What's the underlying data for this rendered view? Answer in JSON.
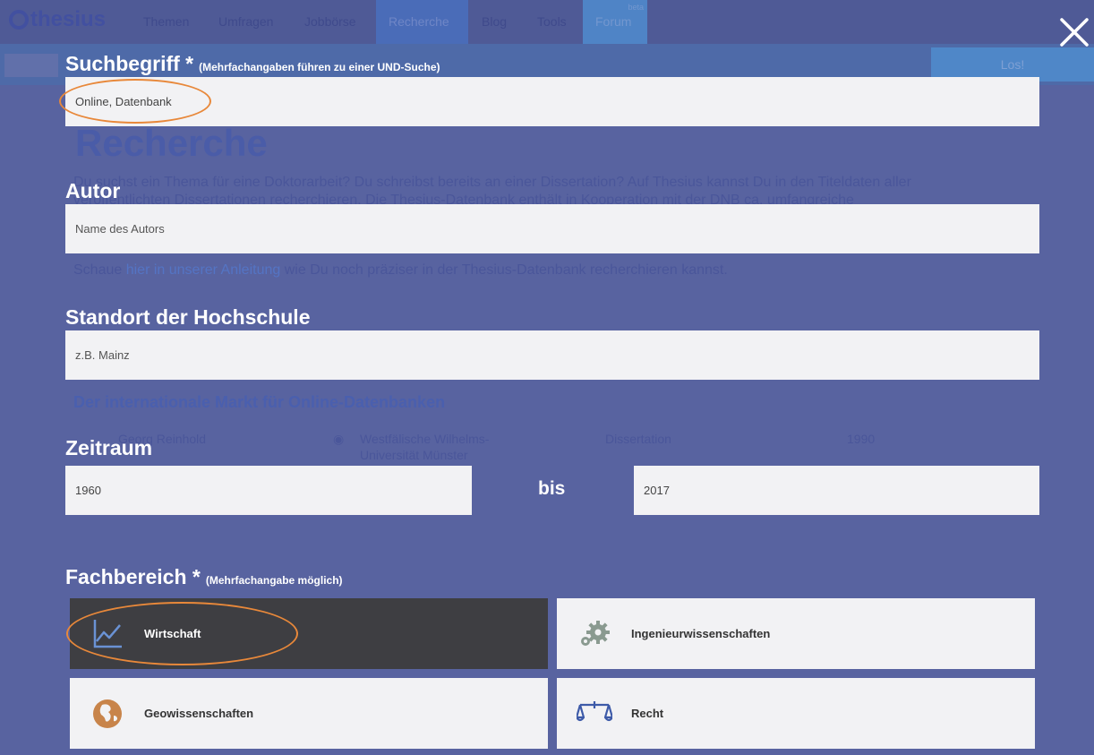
{
  "background": {
    "logo_text": "thesius",
    "nav": [
      "Themen",
      "Umfragen",
      "Jobbörse",
      "Recherche",
      "Blog",
      "Tools",
      "Forum"
    ],
    "forum_badge": "beta",
    "search_button": "Los!",
    "page_title": "Recherche",
    "intro_line1": "Du suchst ein Thema für eine Doktorarbeit? Du schreibst bereits an einer Dissertation? Auf Thesius kannst Du in den Titeldaten aller",
    "intro_line2": "veröffentlichten Dissertationen recherchieren. Die Thesius-Datenbank enthält in Kooperation mit der DNB ca. umfangreiche",
    "hint_prefix": "Schaue",
    "hint_link": "hier in unserer Anleitung",
    "hint_suffix": "wie Du noch präziser in der Thesius-Datenbank recherchieren kannst.",
    "result_title": "Der internationale Markt für Online-Datenbanken",
    "result_author": "Georg Reinhold",
    "result_university_line1": "Westfälische Wilhelms-",
    "result_university_line2": "Universität Münster",
    "result_type": "Dissertation",
    "result_year": "1990"
  },
  "form": {
    "search_label": "Suchbegriff *",
    "search_hint": "(Mehrfachangaben führen zu einer UND-Suche)",
    "search_value": "Online, Datenbank",
    "author_label": "Autor",
    "author_placeholder": "Name des Autors",
    "location_label": "Standort der Hochschule",
    "location_placeholder": "z.B. Mainz",
    "period_label": "Zeitraum",
    "period_from": "1960",
    "period_separator": "bis",
    "period_to": "2017",
    "field_label": "Fachbereich *",
    "field_hint": "(Mehrfachangabe möglich)",
    "fields": [
      {
        "label": "Wirtschaft",
        "icon": "chart-line-icon",
        "selected": true
      },
      {
        "label": "Ingenieurwissenschaften",
        "icon": "gears-icon",
        "selected": false
      },
      {
        "label": "Geowissenschaften",
        "icon": "globe-icon",
        "selected": false
      },
      {
        "label": "Recht",
        "icon": "scales-icon",
        "selected": false
      }
    ]
  },
  "colors": {
    "overlay": "#5863a0",
    "input_bg": "#f2f2f4",
    "tile_selected": "#3e3e42",
    "annotation": "#e8883a"
  }
}
